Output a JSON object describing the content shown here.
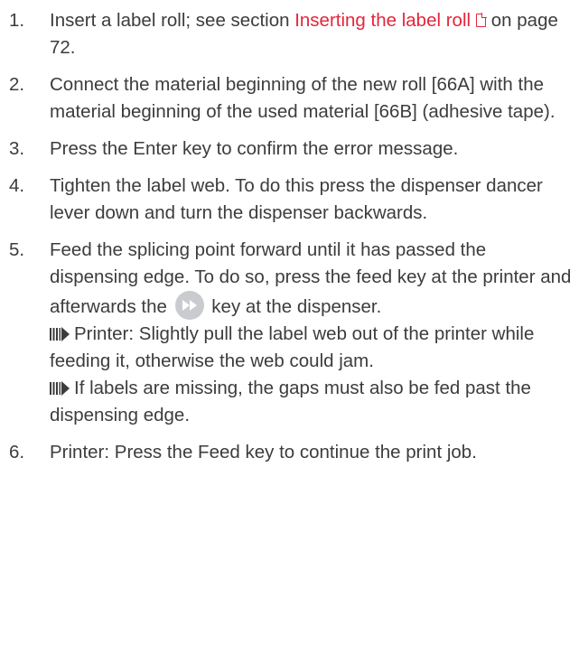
{
  "steps": [
    {
      "number": "1.",
      "text_before": "Insert a label roll; see section ",
      "link_text": "Inserting the label roll",
      "text_after": " on page 72."
    },
    {
      "number": "2.",
      "text": "Connect the material beginning of the new roll [66A] with the material beginning of the used material [66B] (adhesive tape)."
    },
    {
      "number": "3.",
      "text": "Press the Enter key to confirm the error message."
    },
    {
      "number": "4.",
      "text": "Tighten the label web. To do this press the dispen­ser dancer lever down and turn the dispenser back­wards."
    },
    {
      "number": "5.",
      "text_before": "Feed the splicing point forward until it has passed the dispensing edge. To do so, press the feed key at the printer and afterwards the ",
      "text_after": " key at the dis­penser.",
      "notes": [
        "Printer: Slightly pull the label web out of the printer while feeding it, otherwise the web could jam.",
        "If labels are missing, the gaps must also be fed past the dispensing edge."
      ]
    },
    {
      "number": "6.",
      "text": "Printer: Press the Feed key to continue the print job."
    }
  ],
  "icons": {
    "doc": "document-icon",
    "feed_key": "fast-forward-key-icon",
    "result_arrow": "result-arrow-icon"
  },
  "colors": {
    "text": "#3c3c3c",
    "link": "#e3263b",
    "key_icon": "#c9cbce"
  }
}
